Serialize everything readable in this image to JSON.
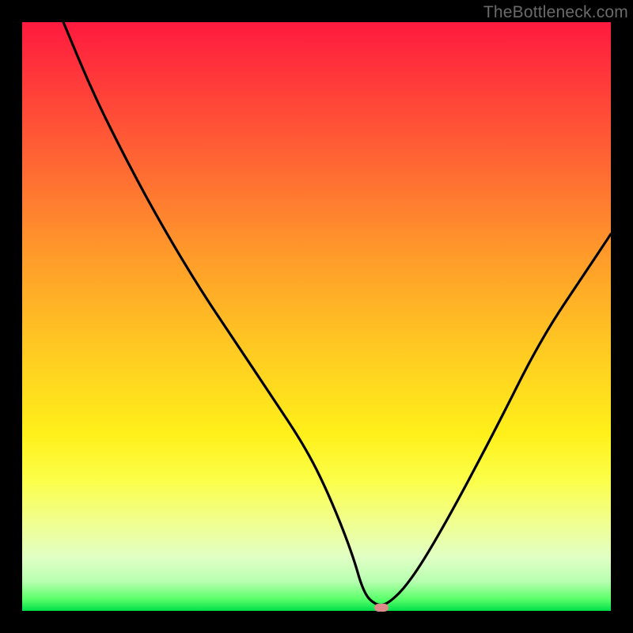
{
  "watermark": "TheBottleneck.com",
  "chart_data": {
    "type": "line",
    "title": "",
    "xlabel": "",
    "ylabel": "",
    "xlim": [
      0,
      100
    ],
    "ylim": [
      0,
      100
    ],
    "grid": false,
    "series": [
      {
        "name": "bottleneck-curve",
        "x": [
          7,
          12,
          18,
          24,
          30,
          36,
          42,
          48,
          52,
          56,
          58,
          60,
          62,
          66,
          72,
          80,
          88,
          96,
          100
        ],
        "values": [
          100,
          88,
          76,
          65,
          55,
          46,
          37,
          28,
          20,
          10,
          3,
          1,
          1,
          5,
          15,
          30,
          46,
          58,
          64
        ]
      }
    ],
    "marker": {
      "x": 61,
      "y": 0.5,
      "color": "#dd8a8a"
    },
    "background_gradient": {
      "top": "#ff1a3f",
      "bottom": "#00e04a"
    }
  }
}
